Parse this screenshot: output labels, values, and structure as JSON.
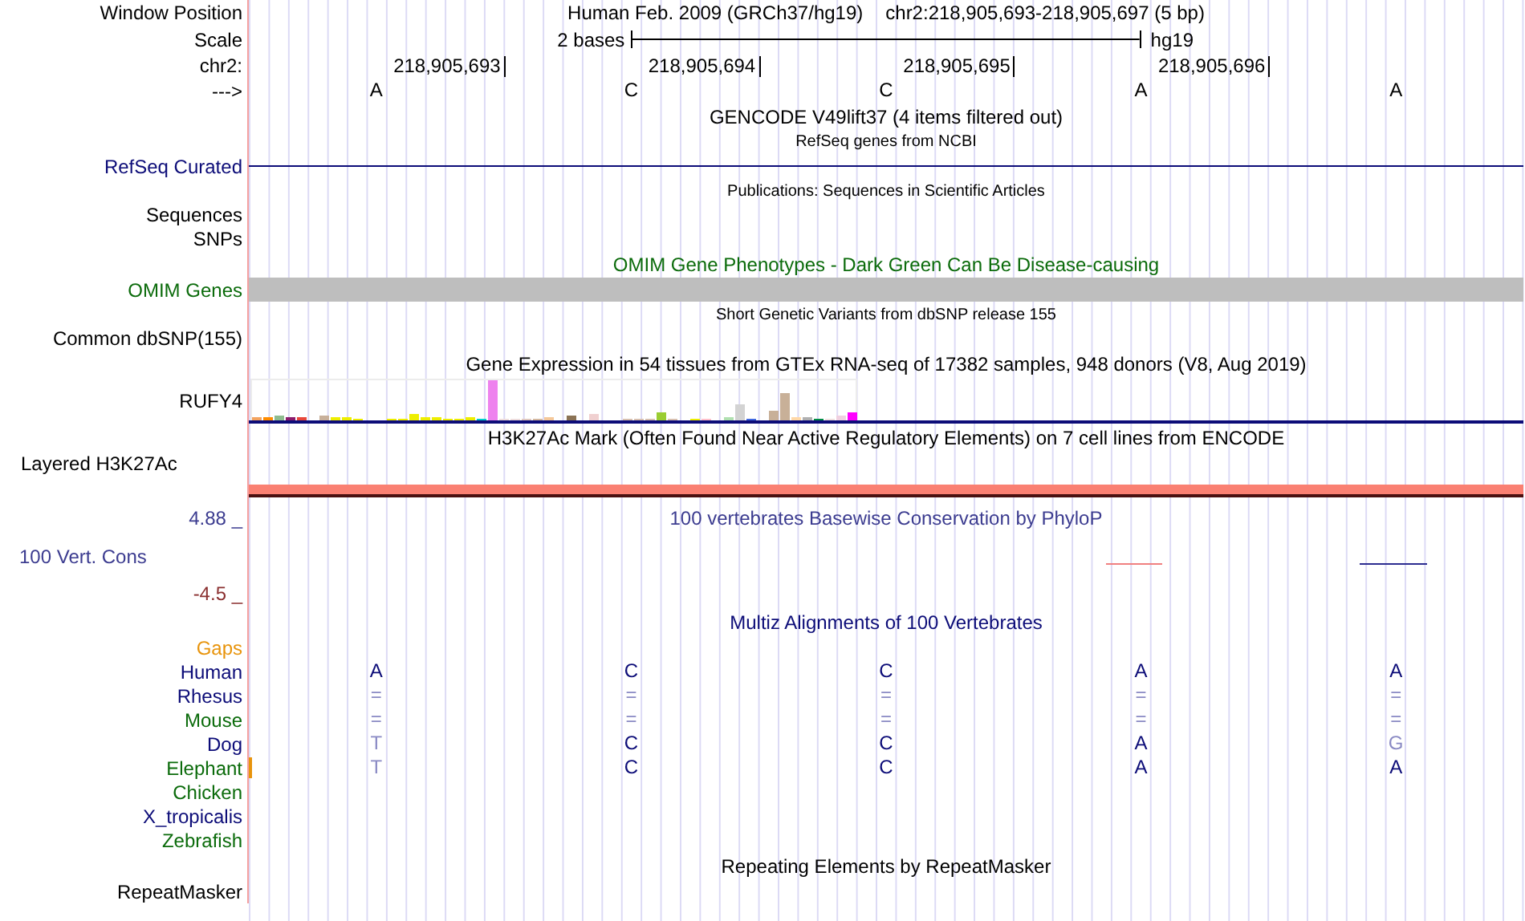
{
  "rows": [
    {
      "kind": "position",
      "label": "Window Position",
      "assembly": "Human Feb. 2009 (GRCh37/hg19)",
      "range": "chr2:218,905,693-218,905,697 (5 bp)"
    },
    {
      "kind": "scale",
      "label": "Scale",
      "span": "2 bases",
      "assembly": "hg19"
    },
    {
      "kind": "coordinates",
      "label": "chr2:",
      "ticks": [
        "218,905,693",
        "218,905,694",
        "218,905,695",
        "218,905,696"
      ]
    },
    {
      "kind": "bases",
      "label": "--->",
      "bases": [
        "A",
        "C",
        "C",
        "A",
        "A"
      ]
    },
    {
      "kind": "title",
      "small": false,
      "color": "#000000",
      "text": "GENCODE V49lift37 (4 items filtered out)"
    },
    {
      "kind": "title",
      "small": true,
      "color": "#000000",
      "text": "RefSeq genes from NCBI"
    },
    {
      "kind": "line",
      "label": "RefSeq Curated",
      "color": "#0c0c78"
    },
    {
      "kind": "title",
      "small": true,
      "color": "#000000",
      "text": "Publications: Sequences in Scientific Articles"
    },
    {
      "kind": "empty",
      "label": "Sequences"
    },
    {
      "kind": "empty",
      "label": "SNPs"
    },
    {
      "kind": "title",
      "small": false,
      "color": "#0b6b0b",
      "text": "OMIM Gene Phenotypes - Dark Green Can Be Disease-causing"
    },
    {
      "kind": "bar",
      "label": "OMIM Genes",
      "color": "#0b6b0b"
    },
    {
      "kind": "title",
      "small": true,
      "color": "#000000",
      "text": "Short Genetic Variants from dbSNP release 155"
    },
    {
      "kind": "empty",
      "label": "Common dbSNP(155)"
    },
    {
      "kind": "title",
      "small": false,
      "color": "#000000",
      "text": "Gene Expression in 54 tissues from GTEx RNA-seq of 17382 samples, 948 donors (V8, Aug 2019)"
    },
    {
      "kind": "expression",
      "label": "RUFY4"
    },
    {
      "kind": "title",
      "small": false,
      "color": "#000000",
      "text": "H3K27Ac Mark (Often Found Near Active Regulatory Elements) on 7 cell lines from ENCODE"
    },
    {
      "kind": "signal",
      "label": "Layered H3K27Ac"
    },
    {
      "kind": "wiggle",
      "max_label": "4.88 _",
      "label": "100 Vert. Cons",
      "min_label": "-4.5 _",
      "title": "100 vertebrates Basewise Conservation by PhyloP"
    },
    {
      "kind": "title",
      "small": false,
      "color": "#0c0c78",
      "text": "Multiz Alignments of 100 Vertebrates"
    },
    {
      "kind": "species",
      "label": "Gaps",
      "color": "#e8940c",
      "gap_mark": false
    },
    {
      "kind": "species",
      "label": "Human",
      "color": "#0c0c78",
      "gap_mark": false,
      "bases": [
        {
          "text": "A",
          "faded": false
        },
        {
          "text": "C",
          "faded": false
        },
        {
          "text": "C",
          "faded": false
        },
        {
          "text": "A",
          "faded": false
        },
        {
          "text": "A",
          "faded": false
        }
      ]
    },
    {
      "kind": "species",
      "label": "Rhesus",
      "color": "#0c0c78",
      "gap_mark": false,
      "bases": [
        {
          "text": "=",
          "faded": true
        },
        {
          "text": "=",
          "faded": true
        },
        {
          "text": "=",
          "faded": true
        },
        {
          "text": "=",
          "faded": true
        },
        {
          "text": "=",
          "faded": true
        }
      ]
    },
    {
      "kind": "species",
      "label": "Mouse",
      "color": "#0b6b0b",
      "gap_mark": false,
      "bases": [
        {
          "text": "=",
          "faded": true
        },
        {
          "text": "=",
          "faded": true
        },
        {
          "text": "=",
          "faded": true
        },
        {
          "text": "=",
          "faded": true
        },
        {
          "text": "=",
          "faded": true
        }
      ]
    },
    {
      "kind": "species",
      "label": "Dog",
      "color": "#0c0c78",
      "gap_mark": false,
      "bases": [
        {
          "text": "T",
          "faded": true
        },
        {
          "text": "C",
          "faded": false
        },
        {
          "text": "C",
          "faded": false
        },
        {
          "text": "A",
          "faded": false
        },
        {
          "text": "G",
          "faded": true
        }
      ]
    },
    {
      "kind": "species",
      "label": "Elephant",
      "color": "#0b6b0b",
      "gap_mark": true,
      "bases": [
        {
          "text": "T",
          "faded": true
        },
        {
          "text": "C",
          "faded": false
        },
        {
          "text": "C",
          "faded": false
        },
        {
          "text": "A",
          "faded": false
        },
        {
          "text": "A",
          "faded": false
        }
      ]
    },
    {
      "kind": "species",
      "label": "Chicken",
      "color": "#0b6b0b",
      "gap_mark": false
    },
    {
      "kind": "species",
      "label": "X_tropicalis",
      "color": "#0c0c78",
      "gap_mark": false
    },
    {
      "kind": "species",
      "label": "Zebrafish",
      "color": "#0b6b0b",
      "gap_mark": false
    },
    {
      "kind": "title",
      "small": false,
      "color": "#000000",
      "text": "Repeating Elements by RepeatMasker"
    },
    {
      "kind": "empty",
      "label": "RepeatMasker"
    }
  ]
}
